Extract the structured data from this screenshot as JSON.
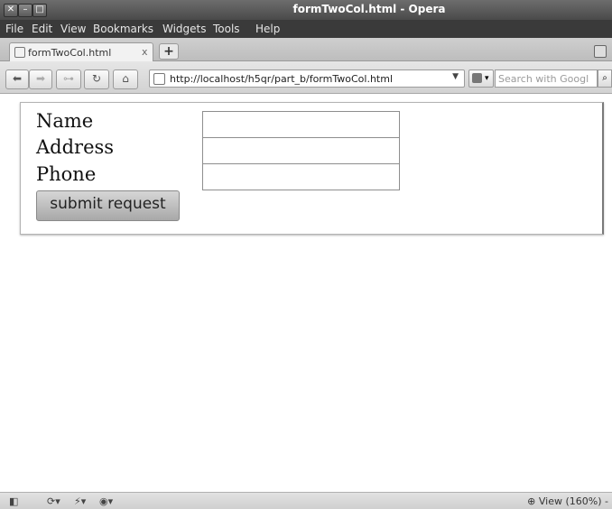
{
  "window": {
    "title": "formTwoCol.html - Opera"
  },
  "menu": [
    "File",
    "Edit",
    "View",
    "Bookmarks",
    "Widgets",
    "Tools",
    "Help"
  ],
  "tab": {
    "label": "formTwoCol.html",
    "close": "x",
    "new_tab": "+"
  },
  "toolbar": {
    "url": "http://localhost/h5qr/part_b/formTwoCol.html",
    "search_placeholder": "Search with Googl",
    "search_icon": "magnifier-icon"
  },
  "form": {
    "fields": [
      {
        "label": "Name",
        "value": ""
      },
      {
        "label": "Address",
        "value": ""
      },
      {
        "label": "Phone",
        "value": ""
      }
    ],
    "submit_label": "submit request"
  },
  "status": {
    "zoom_text": "View (160%)",
    "zoom_suffix": "-"
  }
}
